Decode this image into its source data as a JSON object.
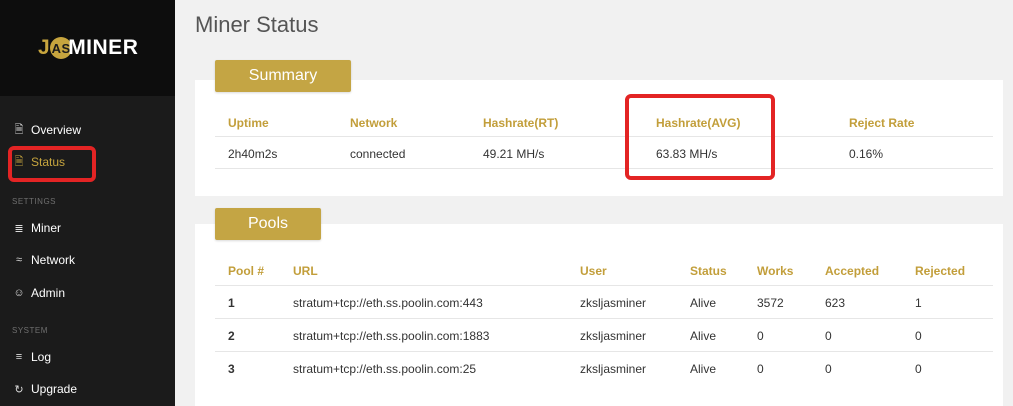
{
  "brand": {
    "logo_text": "MINER",
    "logo_prefix": "J",
    "logo_emblem": "AS"
  },
  "sidebar": {
    "items": [
      {
        "label": "Overview",
        "icon": "document-icon"
      },
      {
        "label": "Status",
        "icon": "document-icon",
        "active": true
      }
    ],
    "sections": [
      {
        "title": "SETTINGS",
        "items": [
          {
            "label": "Miner",
            "icon": "sliders-icon"
          },
          {
            "label": "Network",
            "icon": "wifi-icon"
          },
          {
            "label": "Admin",
            "icon": "users-icon"
          }
        ]
      },
      {
        "title": "SYSTEM",
        "items": [
          {
            "label": "Log",
            "icon": "list-icon"
          },
          {
            "label": "Upgrade",
            "icon": "refresh-icon"
          }
        ]
      }
    ]
  },
  "page": {
    "title": "Miner Status"
  },
  "summary": {
    "tab_label": "Summary",
    "headers": [
      "Uptime",
      "Network",
      "Hashrate(RT)",
      "Hashrate(AVG)",
      "Reject Rate"
    ],
    "row": [
      "2h40m2s",
      "connected",
      "49.21 MH/s",
      "63.83 MH/s",
      "0.16%"
    ]
  },
  "pools": {
    "tab_label": "Pools",
    "headers": [
      "Pool #",
      "URL",
      "User",
      "Status",
      "Works",
      "Accepted",
      "Rejected"
    ],
    "rows": [
      [
        "1",
        "stratum+tcp://eth.ss.poolin.com:443",
        "zksljasminer",
        "Alive",
        "3572",
        "623",
        "1"
      ],
      [
        "2",
        "stratum+tcp://eth.ss.poolin.com:1883",
        "zksljasminer",
        "Alive",
        "0",
        "0",
        "0"
      ],
      [
        "3",
        "stratum+tcp://eth.ss.poolin.com:25",
        "zksljasminer",
        "Alive",
        "0",
        "0",
        "0"
      ]
    ]
  },
  "colors": {
    "accent": "#c4a544",
    "header_text": "#c29e3a",
    "highlight": "#e32424",
    "sidebar_bg": "#1b1b1b"
  }
}
